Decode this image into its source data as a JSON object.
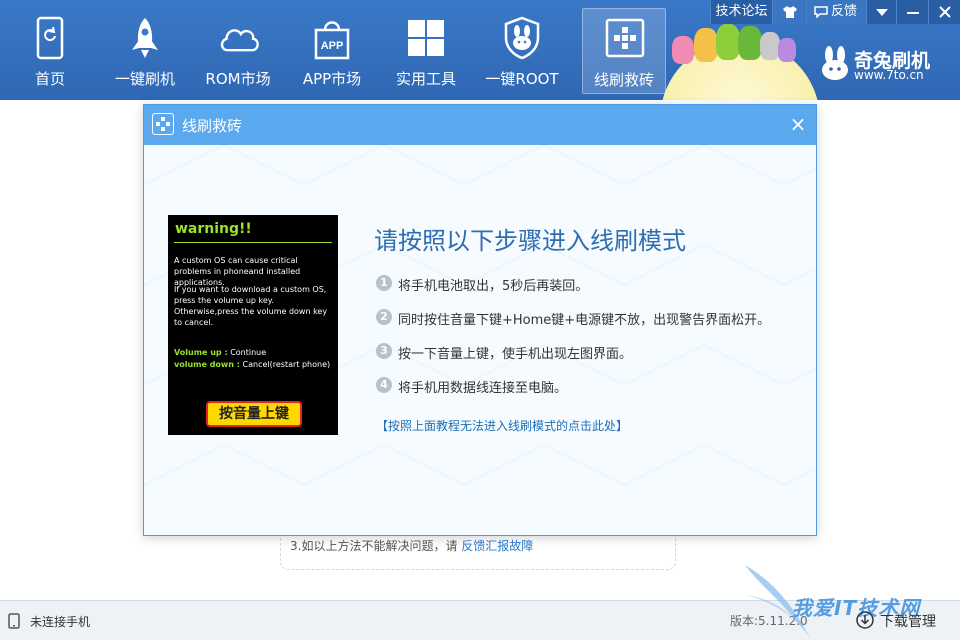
{
  "nav": {
    "items": [
      {
        "label": "首页",
        "icon": "phone-refresh-icon"
      },
      {
        "label": "一键刷机",
        "icon": "rocket-icon"
      },
      {
        "label": "ROM市场",
        "icon": "cloud-icon"
      },
      {
        "label": "APP市场",
        "icon": "app-bag-icon"
      },
      {
        "label": "实用工具",
        "icon": "grid-tools-icon"
      },
      {
        "label": "一键ROOT",
        "icon": "rabbit-shield-icon"
      },
      {
        "label": "线刷救砖",
        "icon": "plus-box-icon"
      }
    ],
    "active_index": 6
  },
  "window": {
    "forum": "技术论坛",
    "feedback": "反馈"
  },
  "brand": {
    "name": "奇兔刷机",
    "url": "www.7to.cn"
  },
  "dialog": {
    "title": "线刷救砖",
    "close": "×",
    "heading": "请按照以下步骤进入线刷模式",
    "steps": [
      {
        "num": "1",
        "text": "将手机电池取出，5秒后再装回。"
      },
      {
        "num": "2",
        "text": "同时按住音量下键+Home键+电源键不放，出现警告界面松开。"
      },
      {
        "num": "3",
        "text": "按一下音量上键，使手机出现左图界面。"
      },
      {
        "num": "4",
        "text": "将手机用数据线连接至电脑。"
      }
    ],
    "help_link": "【按照上面教程无法进入线刷模式的点击此处】",
    "phone": {
      "title": "warning!!",
      "para1": "A custom OS can cause critical problems in phoneand installed applications.",
      "para2": "If you want to download a custom OS, press the volume up key. Otherwise,press the volume down key to cancel.",
      "vol_up_key": "Volume up :",
      "vol_up_val": "Continue",
      "vol_down_key": "volume down :",
      "vol_down_val": "Cancel(restart phone)",
      "button": "按音量上键"
    }
  },
  "background": {
    "line_prefix": "3.如以上方法不能解决问题，请",
    "line_link": "反馈汇报故障"
  },
  "status": {
    "connection": "未连接手机",
    "version": "版本:5.11.2.0",
    "download_manager": "下载管理",
    "watermark": "我爱IT技术网"
  },
  "colors": {
    "toolbar": "#3a79c8",
    "dialog_header": "#5aa9ee",
    "heading": "#2e6db0",
    "link": "#1d6fb8",
    "warning_green": "#9be02a"
  }
}
